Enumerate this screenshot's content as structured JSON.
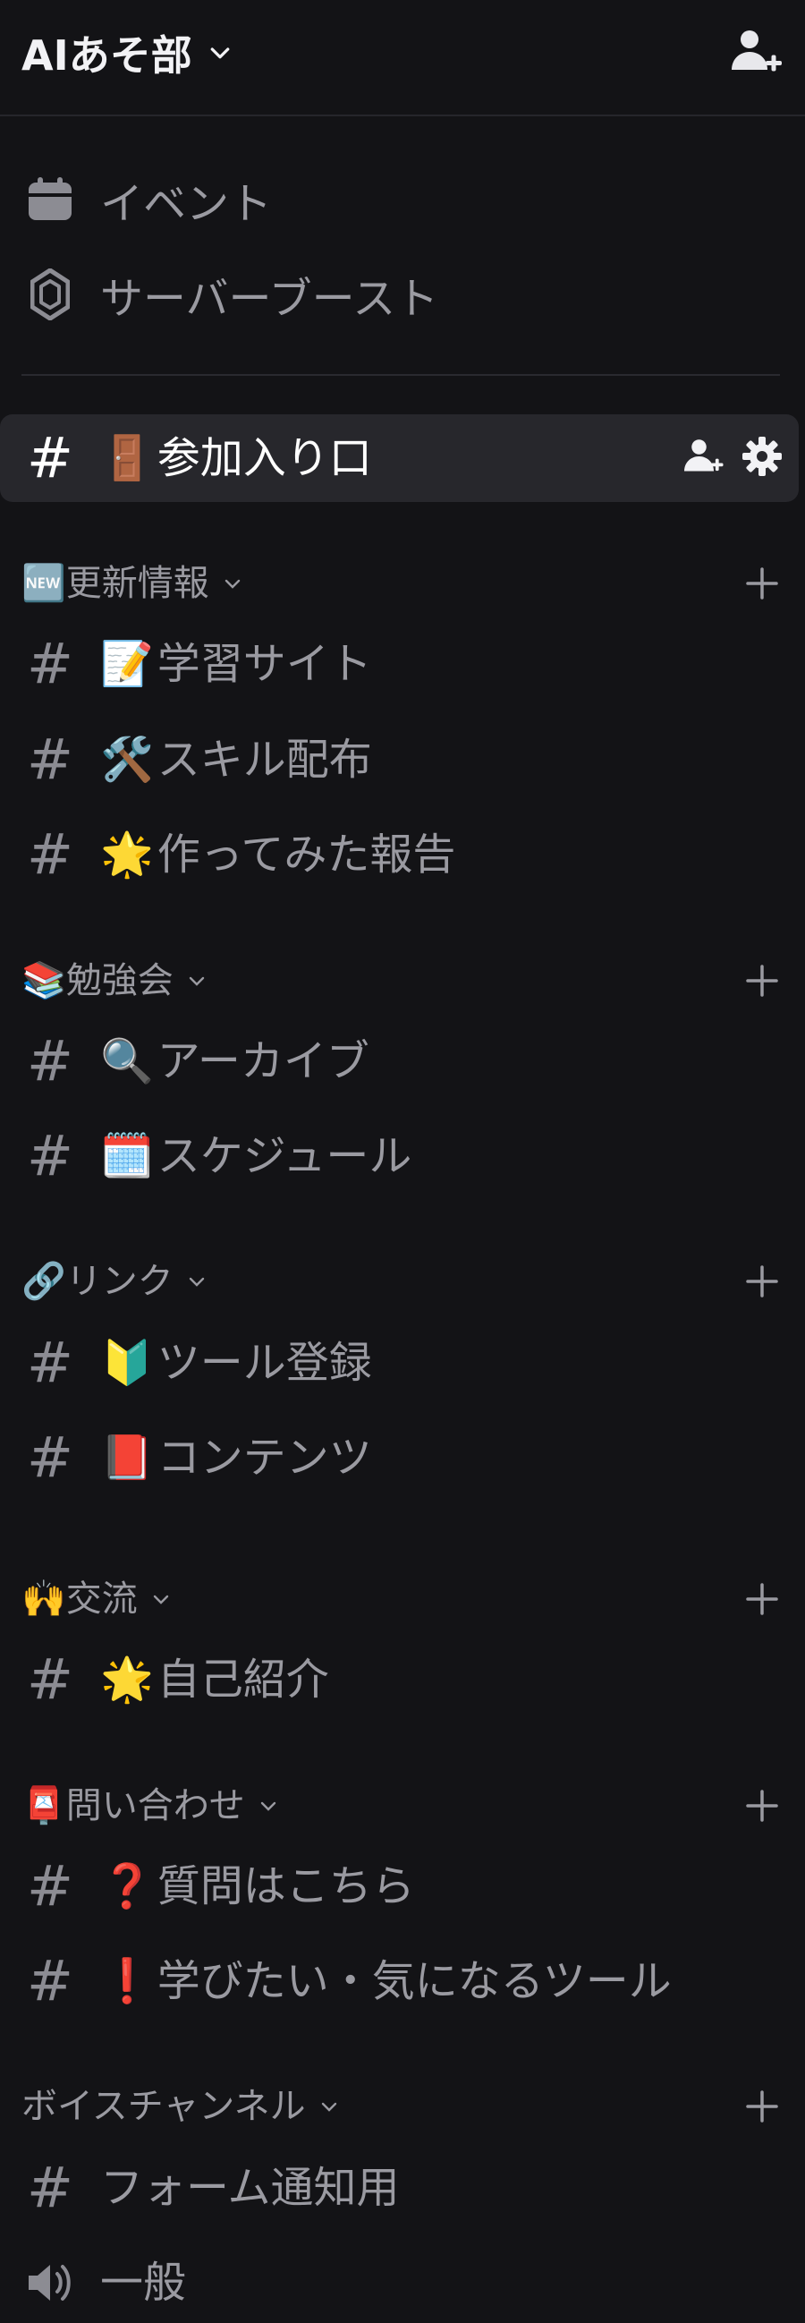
{
  "header": {
    "server_name": "AIあそ部"
  },
  "utilities": [
    {
      "label": "イベント",
      "icon": "calendar-icon"
    },
    {
      "label": "サーバーブースト",
      "icon": "boost-icon"
    }
  ],
  "selected_channel": {
    "emoji": "🚪",
    "name": "参加入り口"
  },
  "categories": [
    {
      "label": "🆕更新情報",
      "channels": [
        {
          "emoji": "📝",
          "name": "学習サイト"
        },
        {
          "emoji": "🛠️",
          "name": "スキル配布"
        },
        {
          "emoji": "🌟",
          "name": "作ってみた報告"
        }
      ]
    },
    {
      "label": "📚勉強会",
      "channels": [
        {
          "emoji": "🔍",
          "name": "アーカイブ"
        },
        {
          "emoji": "🗓️",
          "name": "スケジュール"
        }
      ]
    },
    {
      "label": "🔗リンク",
      "channels": [
        {
          "emoji": "🔰",
          "name": "ツール登録"
        },
        {
          "emoji": "📕",
          "name": "コンテンツ"
        }
      ]
    },
    {
      "label": "🙌交流",
      "channels": [
        {
          "emoji": "🌟",
          "name": "自己紹介"
        }
      ]
    },
    {
      "label": "📮問い合わせ",
      "channels": [
        {
          "emoji": "❓",
          "name": "質問はこちら"
        },
        {
          "emoji": "❗",
          "name": "学びたい・気になるツール"
        }
      ]
    },
    {
      "label": "ボイスチャンネル",
      "channels": [
        {
          "emoji": "",
          "name": "フォーム通知用"
        },
        {
          "emoji": "",
          "name": "一般",
          "voice": true
        }
      ]
    }
  ],
  "colors": {
    "background": "#131316",
    "selected_bg": "#27272c",
    "text": "#9a9aa1",
    "text_active": "#ffffff"
  }
}
